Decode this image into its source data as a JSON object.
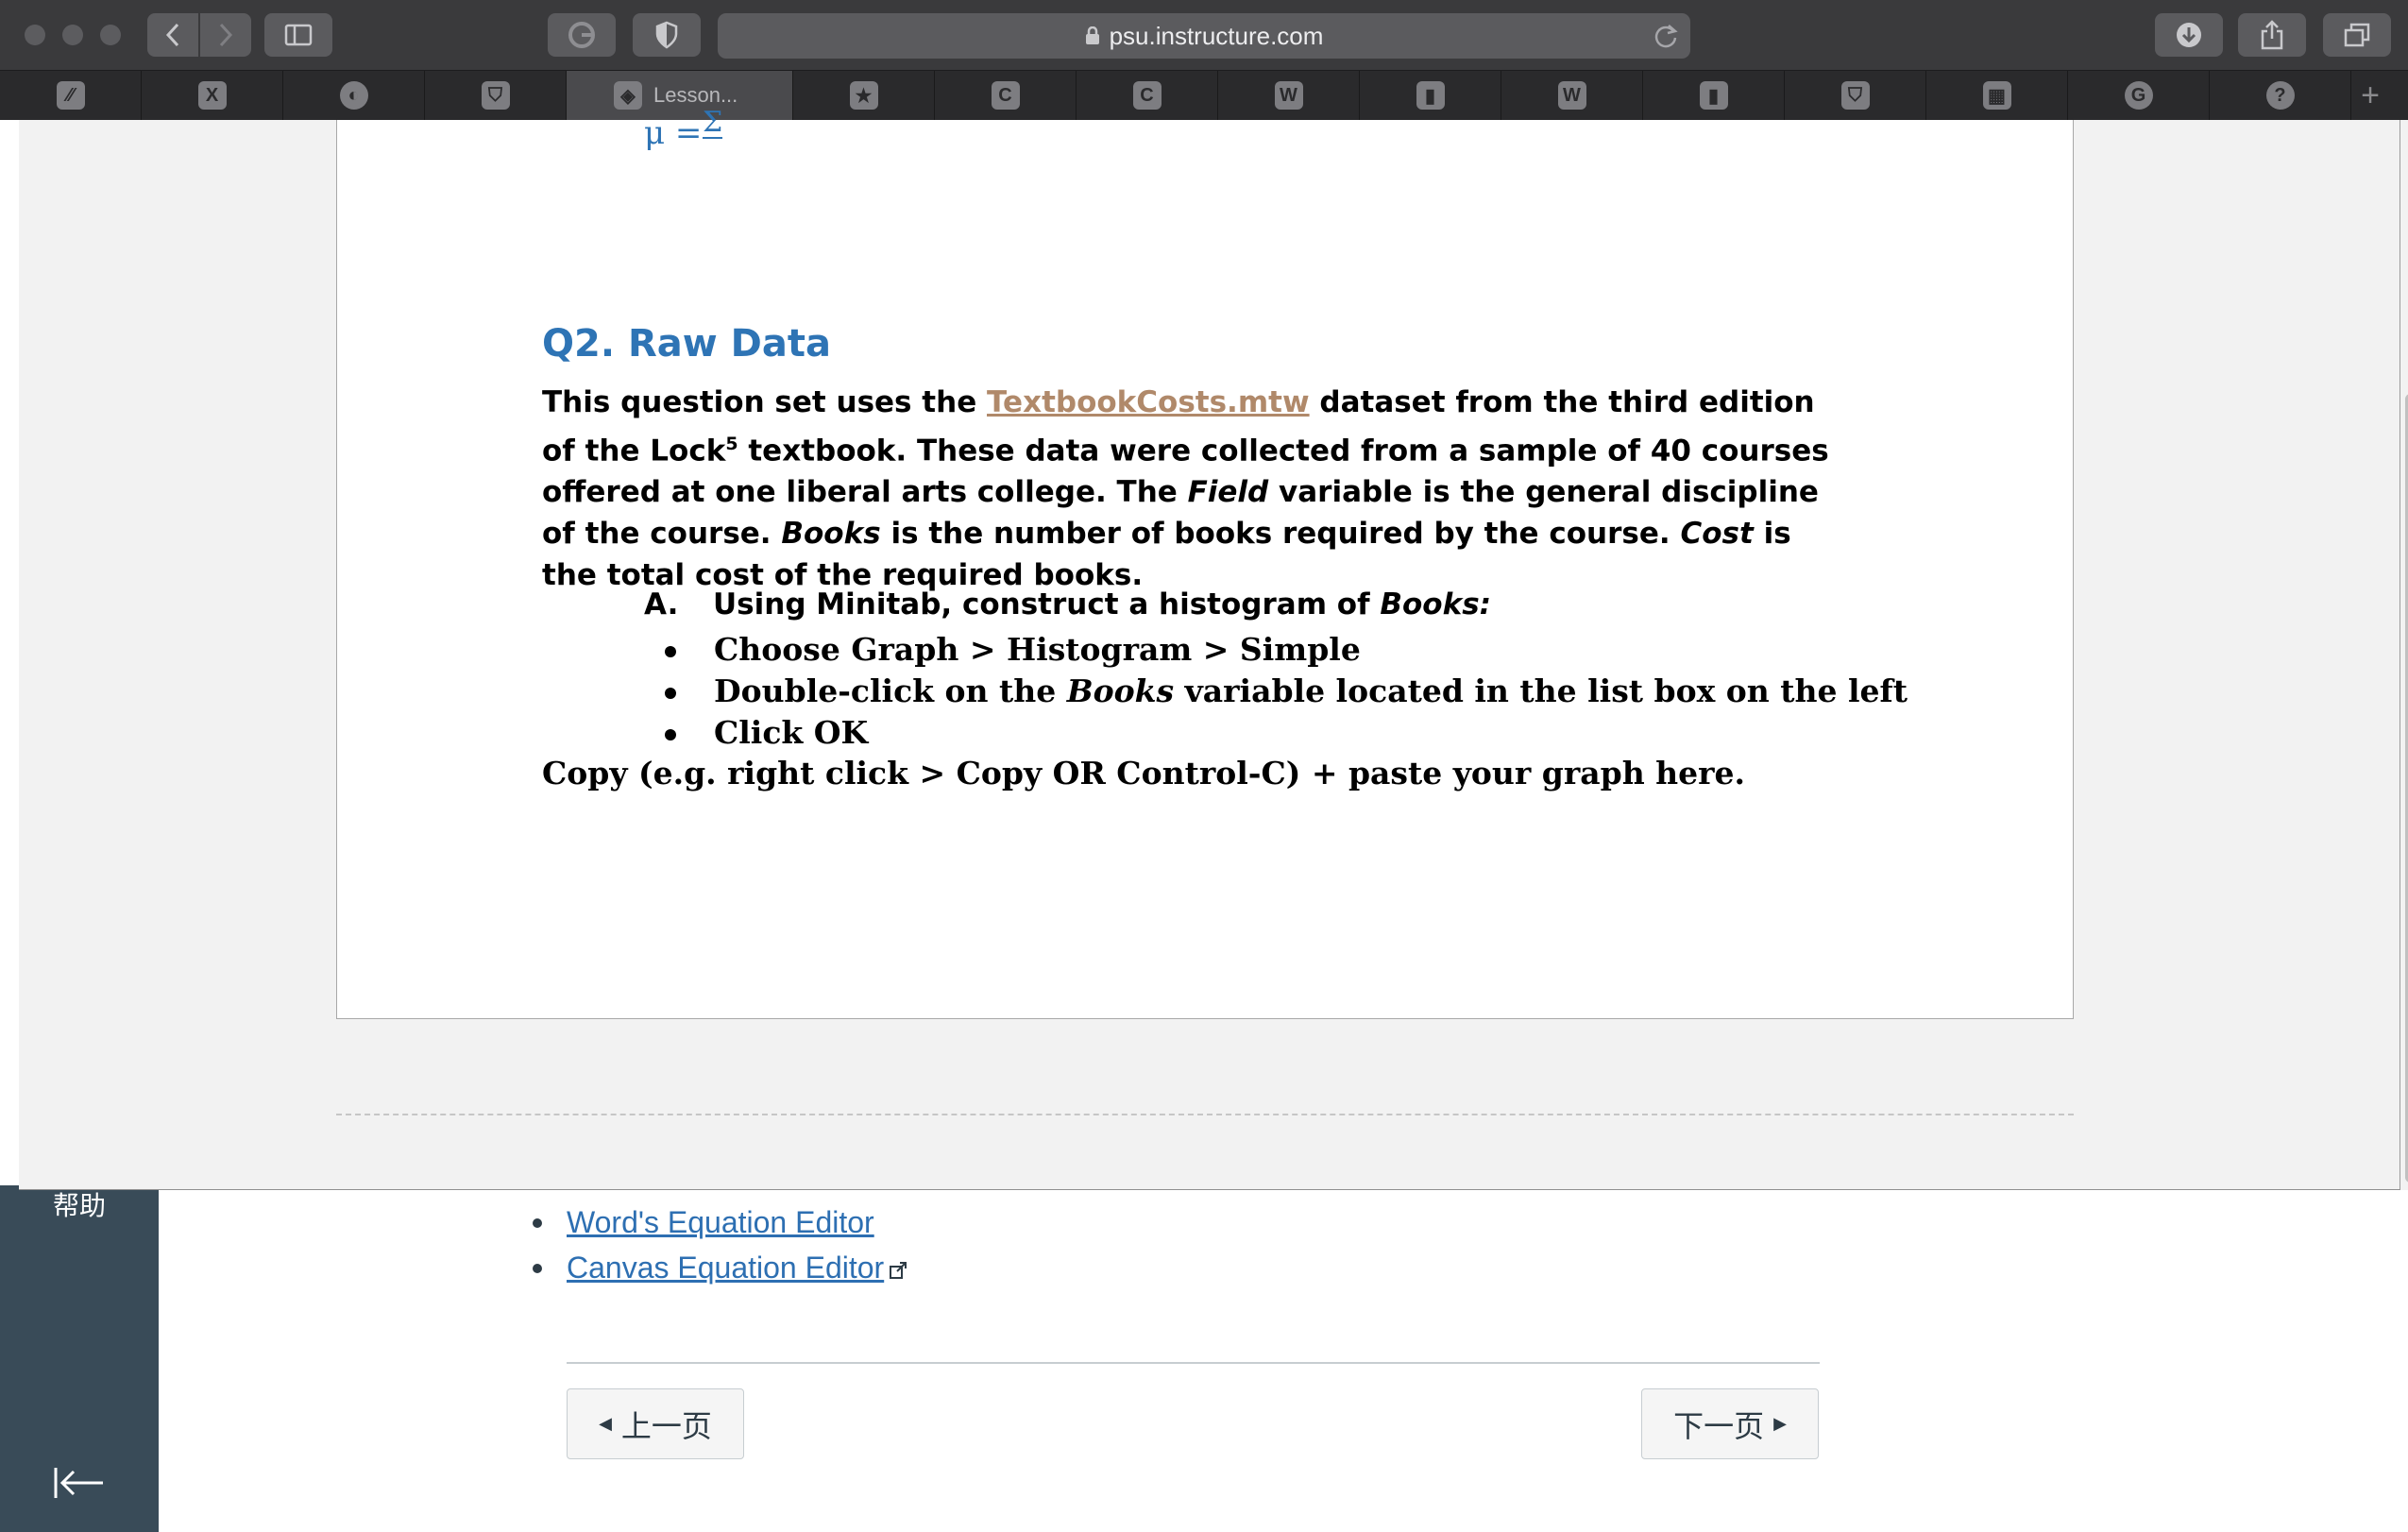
{
  "browser": {
    "url": "psu.instructure.com",
    "active_tab_label": "Lesson...",
    "tabs": [
      {
        "icon": "slash-icon",
        "glyph": "⁄⁄"
      },
      {
        "icon": "x-icon",
        "glyph": "X"
      },
      {
        "icon": "circle-logo-icon",
        "glyph": "◐"
      },
      {
        "icon": "shield-logo-icon",
        "glyph": "⛉"
      },
      {
        "icon": "lesson-icon",
        "glyph": "◈",
        "label": "Lesson..."
      },
      {
        "icon": "star-icon",
        "glyph": "★"
      },
      {
        "icon": "c-icon",
        "glyph": "C"
      },
      {
        "icon": "c-icon",
        "glyph": "C"
      },
      {
        "icon": "w-icon",
        "glyph": "W"
      },
      {
        "icon": "bookmark-icon",
        "glyph": "▮"
      },
      {
        "icon": "w-icon",
        "glyph": "W"
      },
      {
        "icon": "bookmark-icon",
        "glyph": "▮"
      },
      {
        "icon": "shield-logo-icon",
        "glyph": "⛉"
      },
      {
        "icon": "grid-icon",
        "glyph": "▦"
      },
      {
        "icon": "grammarly-icon",
        "glyph": "G"
      },
      {
        "icon": "help-icon",
        "glyph": "?"
      }
    ]
  },
  "document": {
    "formula_prefix": "μ =",
    "formula_sigma": "Σ",
    "q2_title": "Q2. Raw Data",
    "intro_text_1": "This question set uses the ",
    "dataset_link": "TextbookCosts.mtw",
    "intro_text_2": " dataset from the third edition of the Lock",
    "footnote": "5",
    "intro_text_3": " textbook. These data were collected from a sample of 40 courses offered at one liberal arts college. The ",
    "field_word": "Field",
    "intro_text_4": " variable is the general discipline of the course. ",
    "books_word": "Books",
    "intro_text_5": " is the number of books required by the course. ",
    "cost_word": "Cost",
    "intro_text_6": " is the total cost of the required books.",
    "step_a_label": "A.",
    "step_a_text": "Using Minitab, construct a histogram of ",
    "step_a_books": "Books:",
    "bullet_1": "Choose Graph > Histogram > Simple",
    "bullet_2a": "Double-click on the ",
    "bullet_2_books": "Books",
    "bullet_2b": " variable located in the list box on the left",
    "bullet_3": "Click OK",
    "copy_line": "Copy (e.g. right click > Copy OR Control-C) + paste your graph here."
  },
  "page": {
    "help_label": "帮助",
    "links": [
      "Word's Equation Editor",
      "Canvas Equation Editor"
    ],
    "prev_button": "上一页",
    "next_button": "下一页"
  }
}
